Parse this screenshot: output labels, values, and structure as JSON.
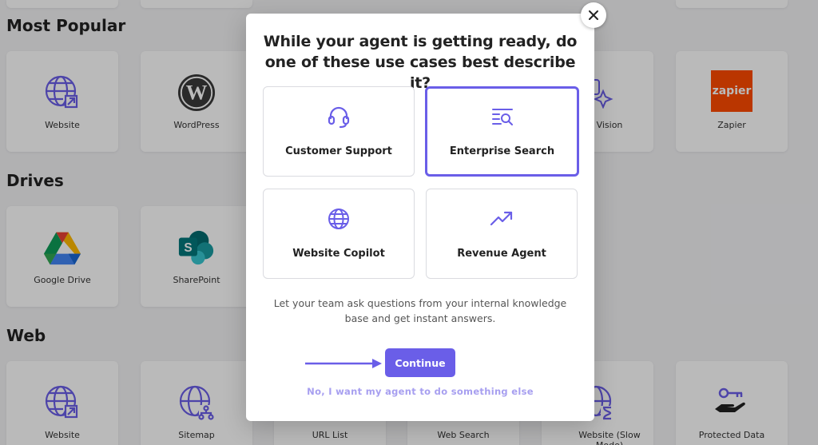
{
  "background": {
    "sections": [
      {
        "title": "Most Popular",
        "cards": [
          "Website",
          "WordPress",
          "",
          "",
          "Vision",
          "Zapier"
        ]
      },
      {
        "title": "Drives",
        "cards": [
          "Google Drive",
          "SharePoint"
        ]
      },
      {
        "title": "Web",
        "cards": [
          "Website",
          "Sitemap",
          "URL List",
          "Web Search",
          "Website (Slow Mode)",
          "Protected Data"
        ]
      }
    ],
    "zapier_logo_text": "zapier"
  },
  "modal": {
    "title": "While your agent is getting ready, do one of these use cases best describe it?",
    "options": [
      {
        "label": "Customer Support",
        "icon": "headset-icon",
        "selected": false
      },
      {
        "label": "Enterprise Search",
        "icon": "search-list-icon",
        "selected": true
      },
      {
        "label": "Website Copilot",
        "icon": "globe-icon",
        "selected": false
      },
      {
        "label": "Revenue Agent",
        "icon": "trending-up-icon",
        "selected": false
      }
    ],
    "description": "Let your team ask questions from your internal knowledge base and get instant answers.",
    "continue_label": "Continue",
    "alt_link": "No, I want my agent to do something else"
  },
  "colors": {
    "accent": "#6a5ee8",
    "accent_light": "#a79ff0",
    "overlay": "rgba(0,0,0,0.27)"
  }
}
